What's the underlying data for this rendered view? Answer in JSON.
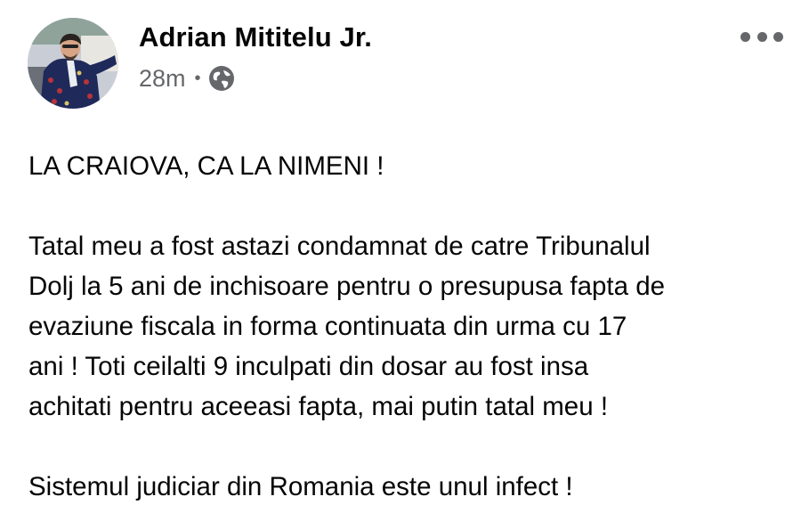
{
  "post": {
    "author_name": "Adrian Mititelu Jr.",
    "timestamp": "28m",
    "separator": "•",
    "audience_icon": "globe-icon",
    "more_icon": "more-options-icon",
    "avatar_icon": "profile-photo",
    "body": {
      "headline": "LA CRAIOVA, CA LA NIMENI !",
      "paragraph_lines": [
        "Tatal meu a fost astazi condamnat de catre Tribunalul",
        "Dolj la 5 ani de inchisoare pentru o presupusa fapta de",
        "evaziune fiscala in forma continuata din urma cu 17",
        "ani ! Toti ceilalti 9 inculpati din dosar au fost insa",
        "achitati pentru aceeasi fapta, mai putin tatal meu !"
      ],
      "closing": "Sistemul judiciar din Romania este unul infect !"
    }
  },
  "colors": {
    "text_primary": "#050505",
    "text_secondary": "#65676b",
    "background": "#ffffff"
  }
}
